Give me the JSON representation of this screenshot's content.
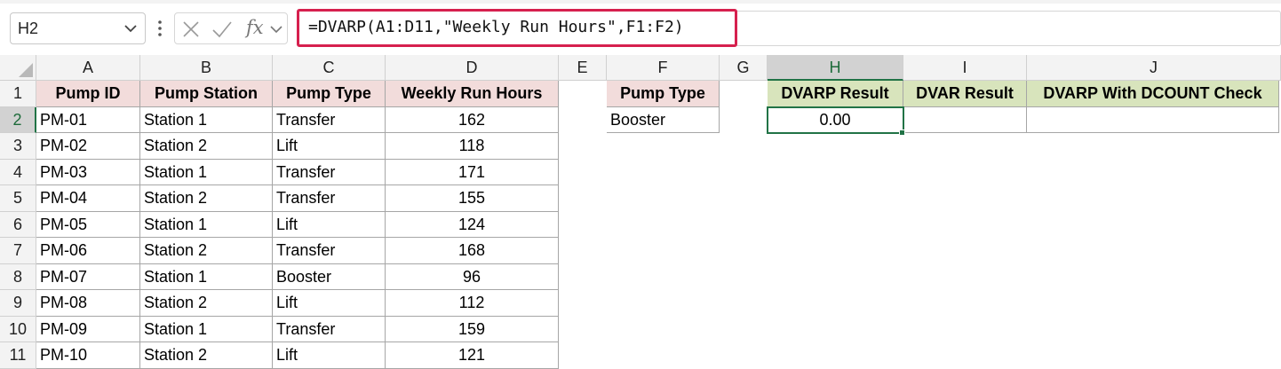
{
  "formula_bar": {
    "name_box": "H2",
    "formula": "=DVARP(A1:D11,\"Weekly Run Hours\",F1:F2)",
    "fx_label": "fx"
  },
  "columns": [
    "A",
    "B",
    "C",
    "D",
    "E",
    "F",
    "G",
    "H",
    "I",
    "J"
  ],
  "rows": [
    "1",
    "2",
    "3",
    "4",
    "5",
    "6",
    "7",
    "8",
    "9",
    "10",
    "11"
  ],
  "table": {
    "headers": [
      "Pump ID",
      "Pump Station",
      "Pump Type",
      "Weekly Run Hours"
    ],
    "rows": [
      [
        "PM-01",
        "Station 1",
        "Transfer",
        "162"
      ],
      [
        "PM-02",
        "Station 2",
        "Lift",
        "118"
      ],
      [
        "PM-03",
        "Station 1",
        "Transfer",
        "171"
      ],
      [
        "PM-04",
        "Station 2",
        "Transfer",
        "155"
      ],
      [
        "PM-05",
        "Station 1",
        "Lift",
        "124"
      ],
      [
        "PM-06",
        "Station 2",
        "Transfer",
        "168"
      ],
      [
        "PM-07",
        "Station 1",
        "Booster",
        "96"
      ],
      [
        "PM-08",
        "Station 2",
        "Lift",
        "112"
      ],
      [
        "PM-09",
        "Station 1",
        "Transfer",
        "159"
      ],
      [
        "PM-10",
        "Station 2",
        "Lift",
        "121"
      ]
    ]
  },
  "criteria": {
    "header": "Pump Type",
    "value": "Booster"
  },
  "results": {
    "headers": [
      "DVARP Result",
      "DVAR Result",
      "DVARP With DCOUNT Check"
    ],
    "values": [
      "0.00",
      "",
      ""
    ]
  },
  "selection": {
    "active_cell": "H2",
    "active_column": "H",
    "active_row": "2"
  },
  "colors": {
    "header_pink": "#f2dcdb",
    "header_green": "#d8e4bc",
    "selection_green": "#217346",
    "formula_highlight": "#d6204e"
  }
}
